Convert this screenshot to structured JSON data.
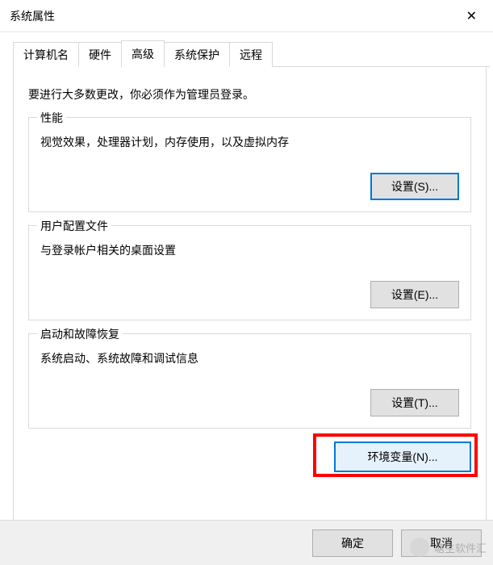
{
  "window": {
    "title": "系统属性",
    "close": "✕"
  },
  "tabs": {
    "computer_name": "计算机名",
    "hardware": "硬件",
    "advanced": "高级",
    "system_protection": "系统保护",
    "remote": "远程"
  },
  "intro": "要进行大多数更改，你必须作为管理员登录。",
  "groups": {
    "performance": {
      "title": "性能",
      "desc": "视觉效果，处理器计划，内存使用，以及虚拟内存",
      "btn": "设置(S)..."
    },
    "user_profiles": {
      "title": "用户配置文件",
      "desc": "与登录帐户相关的桌面设置",
      "btn": "设置(E)..."
    },
    "startup": {
      "title": "启动和故障恢复",
      "desc": "系统启动、系统故障和调试信息",
      "btn": "设置(T)..."
    }
  },
  "env_btn": "环境变量(N)...",
  "footer": {
    "ok": "确定",
    "cancel": "取消"
  },
  "watermark": "塘主软件汇"
}
